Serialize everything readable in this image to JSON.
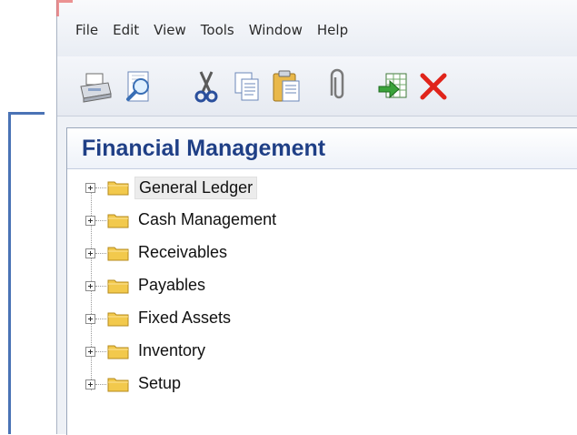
{
  "menu": {
    "items": [
      "File",
      "Edit",
      "View",
      "Tools",
      "Window",
      "Help"
    ]
  },
  "toolbar": {
    "buttons": [
      "print-icon",
      "print-preview-icon",
      "cut-icon",
      "copy-icon",
      "paste-icon",
      "attach-icon",
      "export-icon",
      "delete-icon"
    ]
  },
  "panel": {
    "title": "Financial Management",
    "tree": [
      {
        "label": "General Ledger",
        "selected": true
      },
      {
        "label": "Cash Management"
      },
      {
        "label": "Receivables"
      },
      {
        "label": "Payables"
      },
      {
        "label": "Fixed Assets"
      },
      {
        "label": "Inventory"
      },
      {
        "label": "Setup"
      }
    ]
  },
  "colors": {
    "title": "#1f3f86",
    "callout": "#4a73b5",
    "folder": "#f2c94c",
    "delete": "#e0241b"
  }
}
